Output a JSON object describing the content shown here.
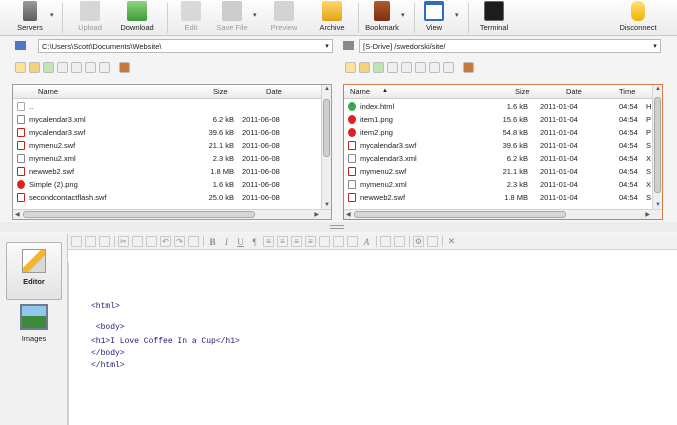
{
  "toolbar": {
    "servers": "Servers",
    "upload": "Upload",
    "download": "Download",
    "edit": "Edit",
    "save_file": "Save File",
    "preview": "Preview",
    "archive": "Archive",
    "bookmark": "Bookmark",
    "view": "View",
    "terminal": "Terminal",
    "disconnect": "Disconnect"
  },
  "local_path": "C:\\Users\\Scott\\Documents\\Website\\",
  "remote_path": "[S-Drive] /swedorski/site/",
  "local_pane": {
    "columns": [
      "Name",
      "Size",
      "Date"
    ],
    "rows": [
      {
        "name": "..",
        "size": "",
        "date": "",
        "icon": "parent-folder-icon"
      },
      {
        "name": "mycalendar3.xml",
        "size": "6.2 kB",
        "date": "2011-06-08",
        "icon": "xml-file-icon"
      },
      {
        "name": "mycalendar3.swf",
        "size": "39.6 kB",
        "date": "2011-06-08",
        "icon": "flash-file-icon"
      },
      {
        "name": "mymenu2.swf",
        "size": "21.1 kB",
        "date": "2011-06-08",
        "icon": "flash-file-icon"
      },
      {
        "name": "mymenu2.xml",
        "size": "2.3 kB",
        "date": "2011-06-08",
        "icon": "xml-file-icon"
      },
      {
        "name": "newweb2.swf",
        "size": "1.8 MB",
        "date": "2011-06-08",
        "icon": "flash-file-icon"
      },
      {
        "name": "Simple (2).png",
        "size": "1.6 kB",
        "date": "2011-06-08",
        "icon": "png-file-icon"
      },
      {
        "name": "secondcontactflash.swf",
        "size": "25.0 kB",
        "date": "2011-06-08",
        "icon": "flash-file-icon"
      }
    ]
  },
  "remote_pane": {
    "columns": [
      "Name",
      "Size",
      "Date",
      "Time"
    ],
    "sort_indicator": "▲",
    "rows": [
      {
        "name": "index.html",
        "size": "1.6 kB",
        "date": "2011-01-04",
        "time": "04:54",
        "extra": "H",
        "icon": "html-file-icon"
      },
      {
        "name": "item1.png",
        "size": "15.6 kB",
        "date": "2011-01-04",
        "time": "04:54",
        "extra": "P",
        "icon": "png-file-icon"
      },
      {
        "name": "item2.png",
        "size": "54.8 kB",
        "date": "2011-01-04",
        "time": "04:54",
        "extra": "P",
        "icon": "png-file-icon"
      },
      {
        "name": "mycalendar3.swf",
        "size": "39.6 kB",
        "date": "2011-01-04",
        "time": "04:54",
        "extra": "S",
        "icon": "flash-file-icon"
      },
      {
        "name": "mycalendar3.xml",
        "size": "6.2 kB",
        "date": "2011-01-04",
        "time": "04:54",
        "extra": "X",
        "icon": "xml-file-icon"
      },
      {
        "name": "mymenu2.swf",
        "size": "21.1 kB",
        "date": "2011-01-04",
        "time": "04:54",
        "extra": "S",
        "icon": "flash-file-icon"
      },
      {
        "name": "mymenu2.xml",
        "size": "2.3 kB",
        "date": "2011-01-04",
        "time": "04:54",
        "extra": "X",
        "icon": "xml-file-icon"
      },
      {
        "name": "newweb2.swf",
        "size": "1.8 MB",
        "date": "2011-01-04",
        "time": "04:54",
        "extra": "S",
        "icon": "flash-file-icon"
      }
    ]
  },
  "side_rail": {
    "editor": "Editor",
    "images": "Images"
  },
  "editor_toolbar": {
    "bold": "B",
    "italic": "I",
    "underline": "U",
    "pilcrow": "¶",
    "close": "✕"
  },
  "code_lines": [
    "<html>",
    " <body>",
    "<h1>I Love Coffee In a Cup</h1>",
    "</body>",
    "</html>"
  ],
  "colors": {
    "code_text": "#1b1b73",
    "flash_icon": "#c81e1e",
    "png_icon": "#e02020",
    "html_icon": "#3aa845"
  }
}
